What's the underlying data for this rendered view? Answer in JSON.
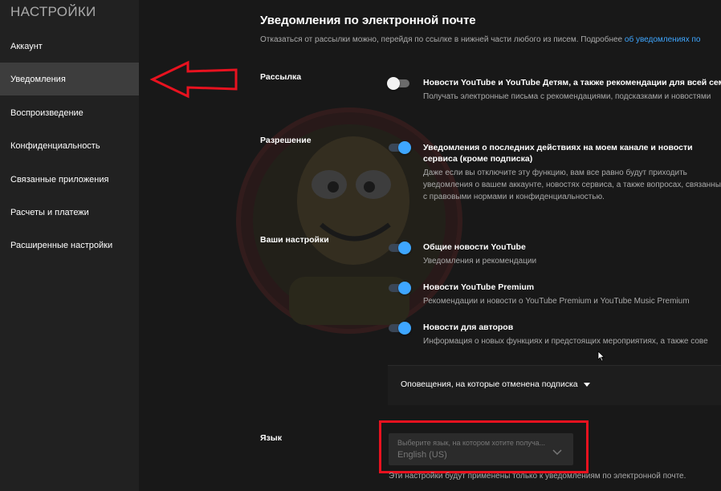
{
  "sidebar": {
    "title": "НАСТРОЙКИ",
    "items": [
      {
        "label": "Аккаунт",
        "active": false
      },
      {
        "label": "Уведомления",
        "active": true
      },
      {
        "label": "Воспроизведение",
        "active": false
      },
      {
        "label": "Конфиденциальность",
        "active": false
      },
      {
        "label": "Связанные приложения",
        "active": false
      },
      {
        "label": "Расчеты и платежи",
        "active": false
      },
      {
        "label": "Расширенные настройки",
        "active": false
      }
    ]
  },
  "main": {
    "title": "Уведомления по электронной почте",
    "subtitle": "Отказаться от рассылки можно, перейдя по ссылке в нижней части любого из писем. Подробнее ",
    "subtitle_link": "об уведомлениях по",
    "sections": {
      "mailing": {
        "label": "Рассылка",
        "option": {
          "title": "Новости YouTube и YouTube Детям, а также рекомендации для всей семьи",
          "desc": "Получать электронные письма с рекомендациями, подсказками и новостями",
          "enabled": false
        }
      },
      "permission": {
        "label": "Разрешение",
        "option": {
          "title": "Уведомления о последних действиях на моем канале и новости сервиса (кроме подписка)",
          "desc": "Даже если вы отключите эту функцию, вам все равно будут приходить уведомления о вашем аккаунте, новостях сервиса, а также вопросах, связанных с правовыми нормами и конфиденциальностью.",
          "enabled": true
        }
      },
      "your_settings": {
        "label": "Ваши настройки",
        "options": [
          {
            "title": "Общие новости YouTube",
            "desc": "Уведомления и рекомендации",
            "enabled": true
          },
          {
            "title": "Новости YouTube Premium",
            "desc": "Рекомендации и новости о YouTube Premium и YouTube Music Premium",
            "enabled": true
          },
          {
            "title": "Новости для авторов",
            "desc": "Информация о новых функциях и предстоящих мероприятиях, а также сове",
            "enabled": true
          }
        ]
      }
    },
    "unsubscribed": {
      "label": "Оповещения, на которые отменена подписка",
      "icon": "caret-down-icon"
    },
    "language": {
      "label": "Язык",
      "placeholder": "Выберите язык, на котором хотите получа...",
      "value": "English (US)"
    },
    "footer_note": "Эти настройки будут применены только к уведомлениям по электронной почте."
  },
  "colors": {
    "background": "#181818",
    "sidebar": "#212121",
    "active_item": "#3d3d3d",
    "accent": "#3ea6ff",
    "annotation": "#e8121f"
  }
}
